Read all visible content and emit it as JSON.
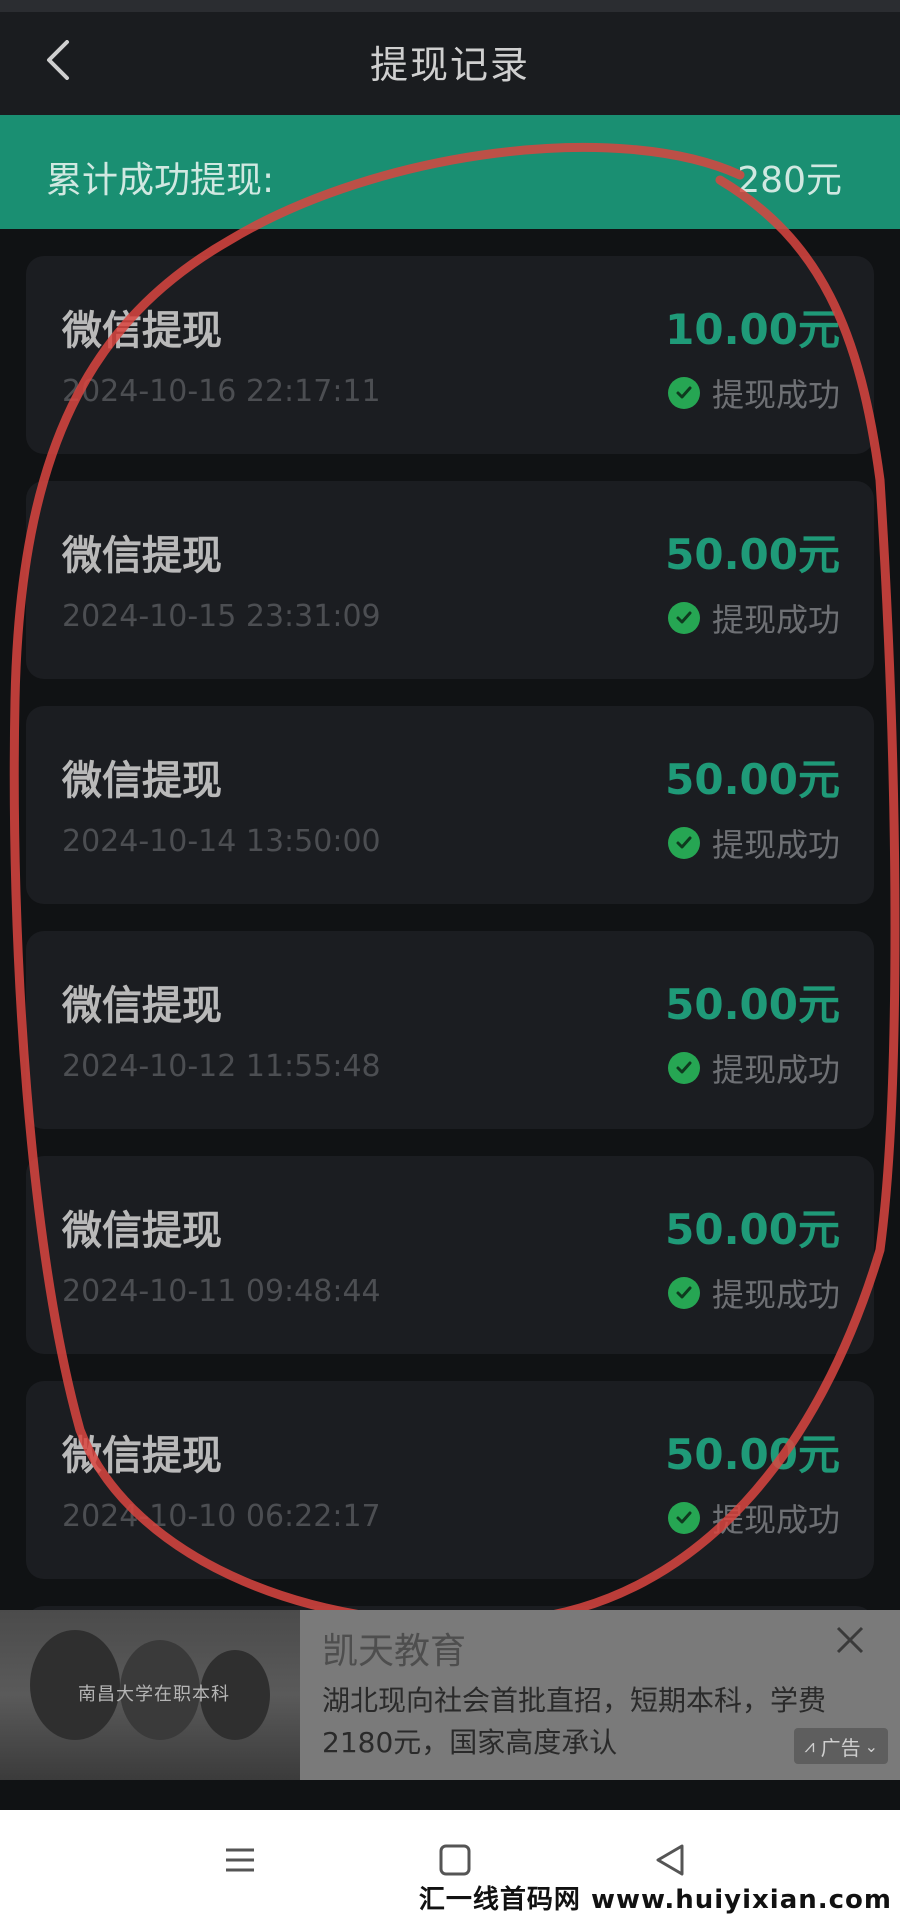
{
  "header": {
    "title": "提现记录"
  },
  "summary": {
    "label": "累计成功提现:",
    "value": "280元"
  },
  "records": [
    {
      "method": "微信提现",
      "amount": "10.00元",
      "time": "2024-10-16 22:17:11",
      "status": "提现成功"
    },
    {
      "method": "微信提现",
      "amount": "50.00元",
      "time": "2024-10-15 23:31:09",
      "status": "提现成功"
    },
    {
      "method": "微信提现",
      "amount": "50.00元",
      "time": "2024-10-14 13:50:00",
      "status": "提现成功"
    },
    {
      "method": "微信提现",
      "amount": "50.00元",
      "time": "2024-10-12 11:55:48",
      "status": "提现成功"
    },
    {
      "method": "微信提现",
      "amount": "50.00元",
      "time": "2024-10-11 09:48:44",
      "status": "提现成功"
    },
    {
      "method": "微信提现",
      "amount": "50.00元",
      "time": "2024-10-10 06:22:17",
      "status": "提现成功"
    }
  ],
  "ad": {
    "image_caption": "南昌大学在职本科",
    "title": "凯天教育",
    "description": "湖北现向社会首批直招，短期本科，学费2180元，国家高度承认",
    "badge": "广告"
  },
  "watermark": "汇一线首码网 www.huiyixian.com",
  "colors": {
    "accent_green": "#1a8f72",
    "amount_green": "#1f9a78",
    "status_icon_green": "#26a653",
    "annotation_red": "#d9453f"
  },
  "icons": {
    "back": "chevron-left-icon",
    "status": "check-circle-icon",
    "close": "close-icon",
    "nav_menu": "menu-icon",
    "nav_home": "square-icon",
    "nav_back": "triangle-back-icon"
  }
}
